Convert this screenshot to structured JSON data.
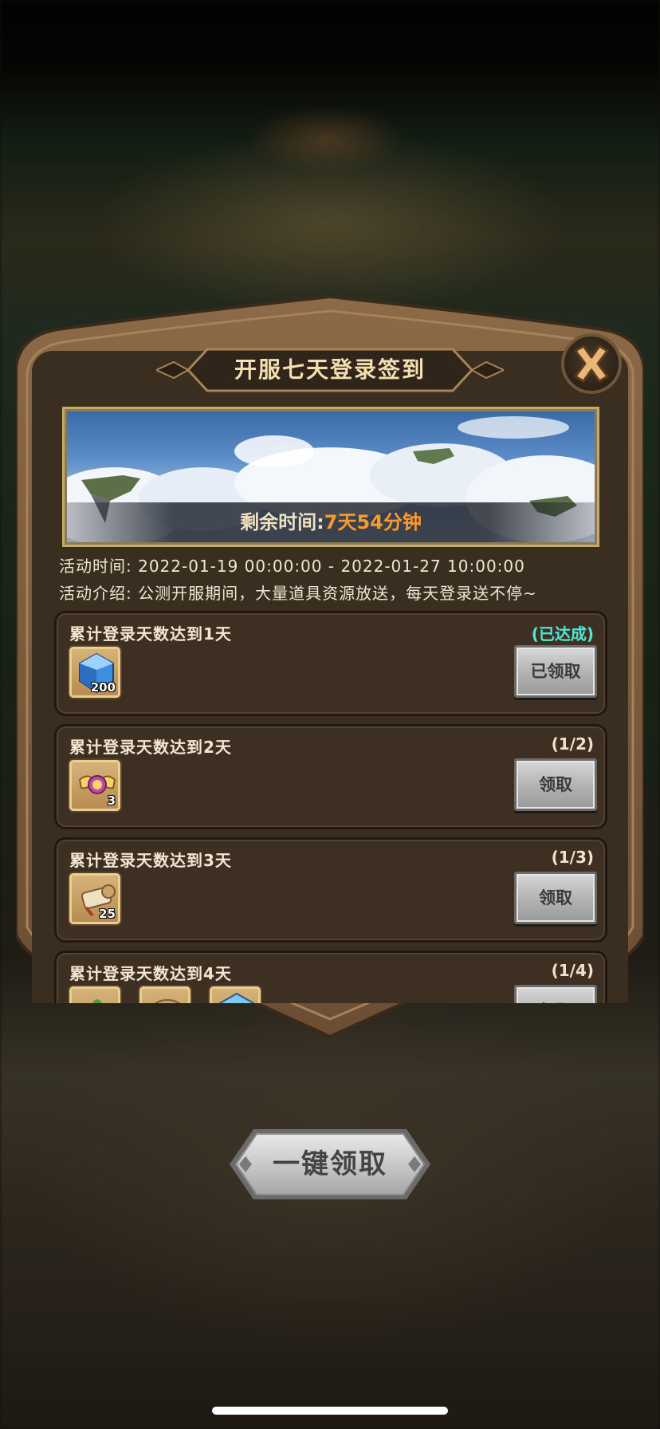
{
  "dialog": {
    "title": "开服七天登录签到",
    "banner": {
      "remaining_label": "剩余时间:",
      "remaining_value": "7天54分钟"
    },
    "activity_time": "活动时间: 2022-01-19 00:00:00 - 2022-01-27 10:00:00",
    "activity_desc": "活动介绍: 公测开服期间，大量道具资源放送，每天登录送不停~",
    "tasks": [
      {
        "title": "累计登录天数达到1天",
        "progress": "(已达成)",
        "completed": true,
        "button": "已领取",
        "rewards": [
          {
            "icon": "blue-gem-icon",
            "count": "200"
          }
        ]
      },
      {
        "title": "累计登录天数达到2天",
        "progress": "(1/2)",
        "completed": false,
        "button": "领取",
        "rewards": [
          {
            "icon": "winged-amulet-icon",
            "count": "3"
          }
        ]
      },
      {
        "title": "累计登录天数达到3天",
        "progress": "(1/3)",
        "completed": false,
        "button": "领取",
        "rewards": [
          {
            "icon": "scroll-icon",
            "count": "25"
          }
        ]
      },
      {
        "title": "累计登录天数达到4天",
        "progress": "(1/4)",
        "completed": false,
        "button": "领取",
        "rewards": [
          {
            "icon": "food-pot-icon",
            "count": ""
          },
          {
            "icon": "scroll-icon",
            "count": ""
          },
          {
            "icon": "blue-gem-icon",
            "count": ""
          }
        ]
      }
    ],
    "claim_all": "一键领取"
  },
  "colors": {
    "accent_orange": "#ff9a2a",
    "completed_cyan": "#4fe7d6",
    "title_text": "#f3dfb0",
    "panel_bg": "#3a2e20"
  }
}
